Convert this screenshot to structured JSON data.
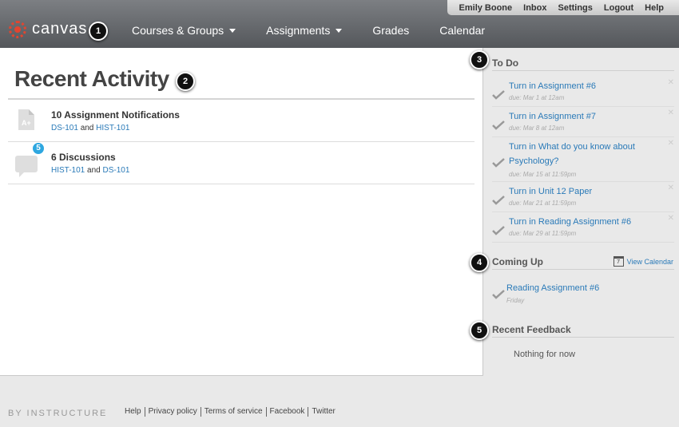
{
  "header": {
    "user_menu": [
      "Emily Boone",
      "Inbox",
      "Settings",
      "Logout",
      "Help"
    ],
    "logo_text": "canvas",
    "nav": [
      {
        "label": "Courses & Groups",
        "has_caret": true
      },
      {
        "label": "Assignments",
        "has_caret": true
      },
      {
        "label": "Grades",
        "has_caret": false
      },
      {
        "label": "Calendar",
        "has_caret": false
      }
    ]
  },
  "callouts": [
    "1",
    "2",
    "3",
    "4",
    "5"
  ],
  "main": {
    "title": "Recent Activity",
    "activities": [
      {
        "title": "10 Assignment Notifications",
        "icon": "assignment-doc-icon",
        "links": [
          "DS-101",
          "HIST-101"
        ],
        "joiner": "and"
      },
      {
        "title": "6 Discussions",
        "icon": "discussion-bubble-icon",
        "badge": "5",
        "links": [
          "HIST-101",
          "DS-101"
        ],
        "joiner": "and"
      }
    ]
  },
  "sidebar": {
    "todo_heading": "To Do",
    "todo": [
      {
        "label": "Turn in Assignment #6",
        "due": "due: Mar 1 at 12am"
      },
      {
        "label": "Turn in Assignment #7",
        "due": "due: Mar 8 at 12am"
      },
      {
        "label": "Turn in What do you know about Psychology?",
        "due": "due: Mar 15 at 11:59pm"
      },
      {
        "label": "Turn in Unit 12 Paper",
        "due": "due: Mar 21 at 11:59pm"
      },
      {
        "label": "Turn in Reading Assignment #6",
        "due": "due: Mar 29 at 11:59pm"
      }
    ],
    "coming_up_heading": "Coming Up",
    "view_calendar": "View Calendar",
    "calendar_day": "7",
    "coming_up": [
      {
        "label": "Reading Assignment #6",
        "when": "Friday"
      }
    ],
    "feedback_heading": "Recent Feedback",
    "feedback_empty": "Nothing for now"
  },
  "footer": {
    "brand": "BY INSTRUCTURE",
    "links": [
      "Help",
      "Privacy policy",
      "Terms of service",
      "Facebook",
      "Twitter"
    ]
  },
  "colors": {
    "link": "#2a7ab8",
    "logo": "#e24530",
    "badge": "#2ea7e0"
  }
}
